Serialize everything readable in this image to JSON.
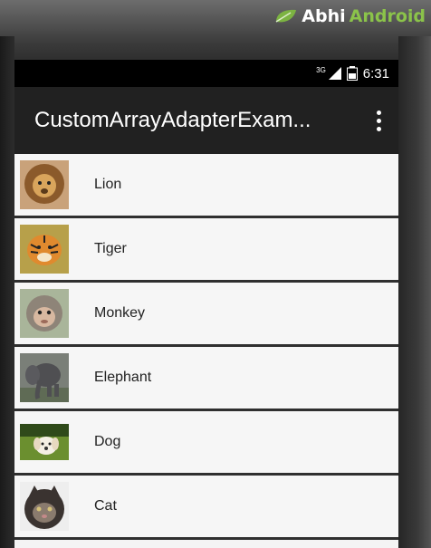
{
  "brand": {
    "part1": "Abhi",
    "part2": "Android"
  },
  "status_bar": {
    "network": "3G",
    "time": "6:31"
  },
  "app_bar": {
    "title": "CustomArrayAdapterExam..."
  },
  "animals": [
    {
      "name": "Lion",
      "icon": "lion-icon"
    },
    {
      "name": "Tiger",
      "icon": "tiger-icon"
    },
    {
      "name": "Monkey",
      "icon": "monkey-icon"
    },
    {
      "name": "Elephant",
      "icon": "elephant-icon"
    },
    {
      "name": "Dog",
      "icon": "dog-icon"
    },
    {
      "name": "Cat",
      "icon": "cat-icon"
    }
  ]
}
